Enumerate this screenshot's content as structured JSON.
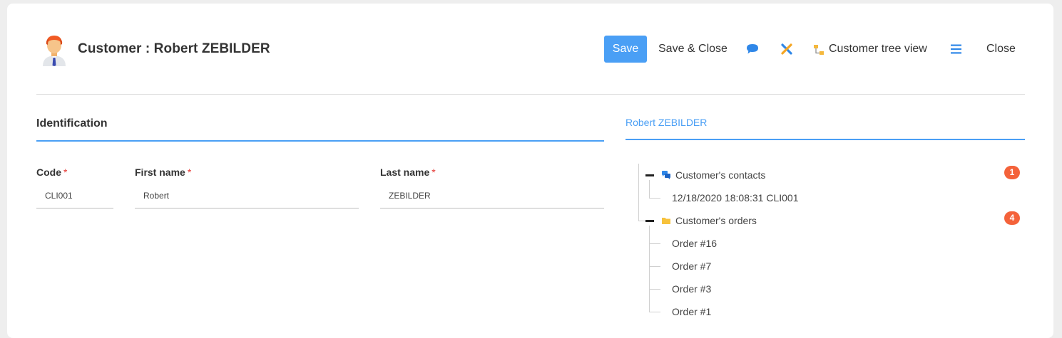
{
  "header": {
    "title": "Customer : Robert ZEBILDER",
    "avatar_icon": "user-avatar-icon"
  },
  "toolbar": {
    "save_label": "Save",
    "save_close_label": "Save & Close",
    "comment_icon": "comment-icon",
    "tools_icon": "tools-icon",
    "tree_view_label": "Customer tree view",
    "tree_view_icon": "tree-view-icon",
    "menu_icon": "menu-icon",
    "close_label": "Close"
  },
  "identification": {
    "title": "Identification",
    "fields": {
      "code": {
        "label": "Code",
        "value": "CLI001",
        "required_mark": "*"
      },
      "first_name": {
        "label": "First name",
        "value": "Robert",
        "required_mark": "*"
      },
      "last_name": {
        "label": "Last name",
        "value": "ZEBILDER",
        "required_mark": "*"
      }
    }
  },
  "tree": {
    "tab_label": "Robert ZEBILDER",
    "contacts": {
      "label": "Customer's contacts",
      "count": "1",
      "icon": "contacts-icon",
      "children": [
        "12/18/2020 18:08:31 CLI001"
      ]
    },
    "orders": {
      "label": "Customer's orders",
      "count": "4",
      "icon": "folder-icon",
      "children": [
        "Order #16",
        "Order #7",
        "Order #3",
        "Order #1"
      ]
    }
  },
  "colors": {
    "accent": "#4a9ff5",
    "badge": "#f4623a",
    "required": "#e53935",
    "folder": "#f7c23c"
  }
}
